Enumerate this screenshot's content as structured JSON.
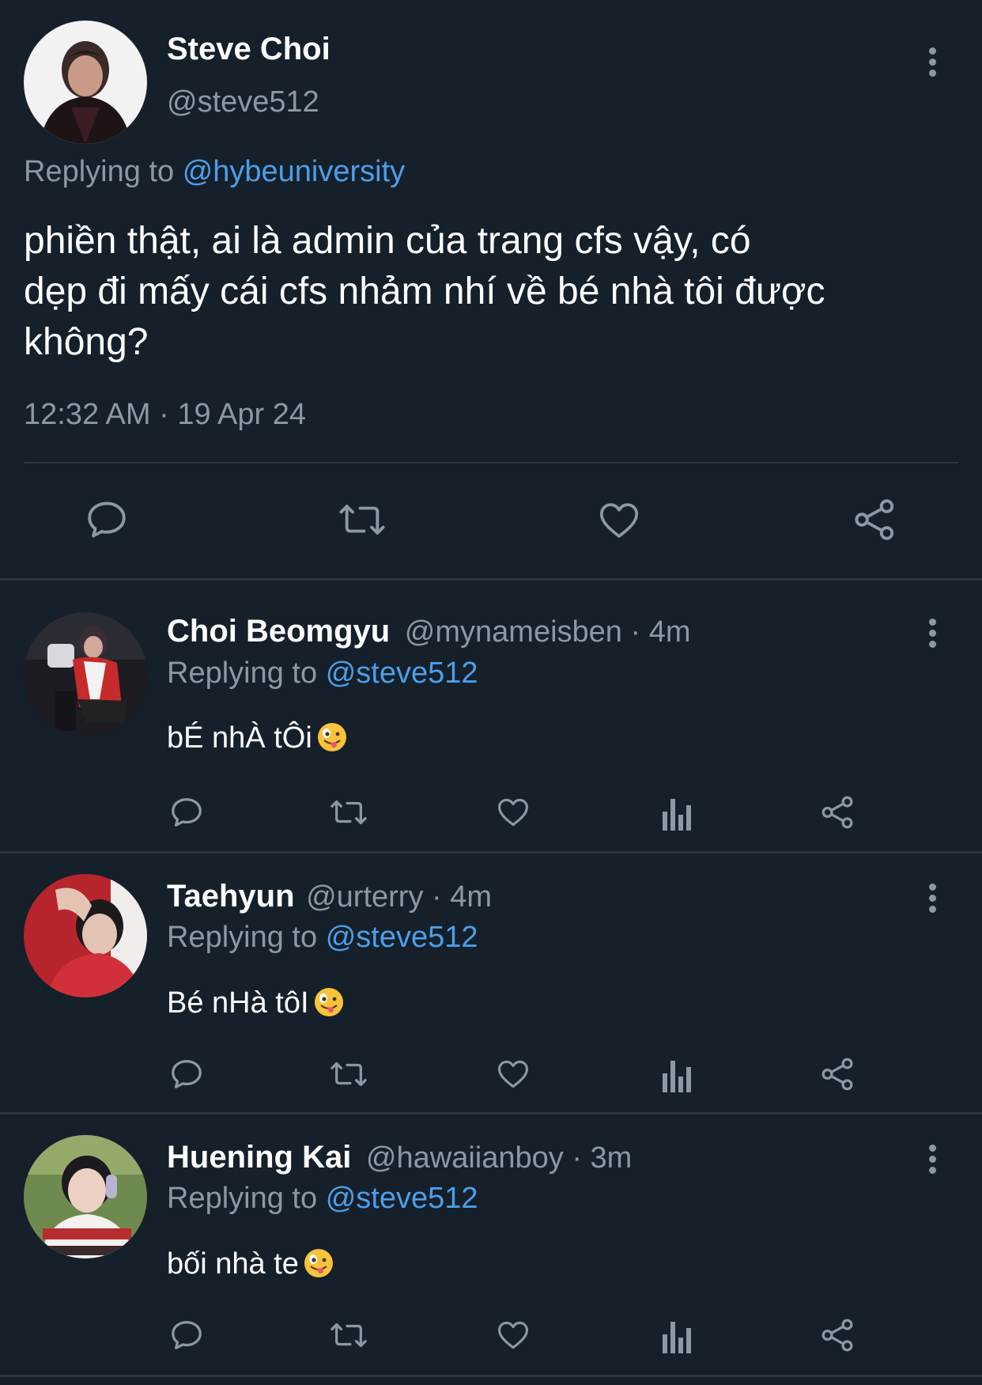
{
  "main_tweet": {
    "author_name": "Steve Choi",
    "author_handle": "@steve512",
    "replying_prefix": "Replying to",
    "replying_handle": "@hybeuniversity",
    "text_lines": [
      "phiền thật, ai là admin của trang cfs vậy, có",
      "dẹp đi mấy cái cfs nhảm nhí về bé nhà tôi được",
      "không?"
    ],
    "timestamp": "12:32 AM · 19 Apr 24",
    "actions": [
      "comment-icon",
      "retweet-icon",
      "heart-icon",
      "share-icon"
    ]
  },
  "replies": [
    {
      "name": "Choi Beomgyu",
      "handle": "@mynameisben",
      "time": "· 4m",
      "replying_prefix": "Replying to",
      "replying_handle": "@steve512",
      "text": "bÉ nhÀ tÔi",
      "emoji": "zany-face-emoji"
    },
    {
      "name": "Taehyun",
      "handle": "@urterry",
      "time": "· 4m",
      "replying_prefix": "Replying to",
      "replying_handle": "@steve512",
      "text": "Bé nHà tôI",
      "emoji": "zany-face-emoji"
    },
    {
      "name": "Huening Kai",
      "handle": "@hawaiianboy",
      "time": "· 3m",
      "replying_prefix": "Replying to",
      "replying_handle": "@steve512",
      "text": "bối nhà te",
      "emoji": "zany-face-emoji"
    }
  ],
  "colors": {
    "background": "#15202b",
    "link": "#4d9ee8",
    "secondary_text": "#8b98a5",
    "divider": "#2c3640"
  }
}
